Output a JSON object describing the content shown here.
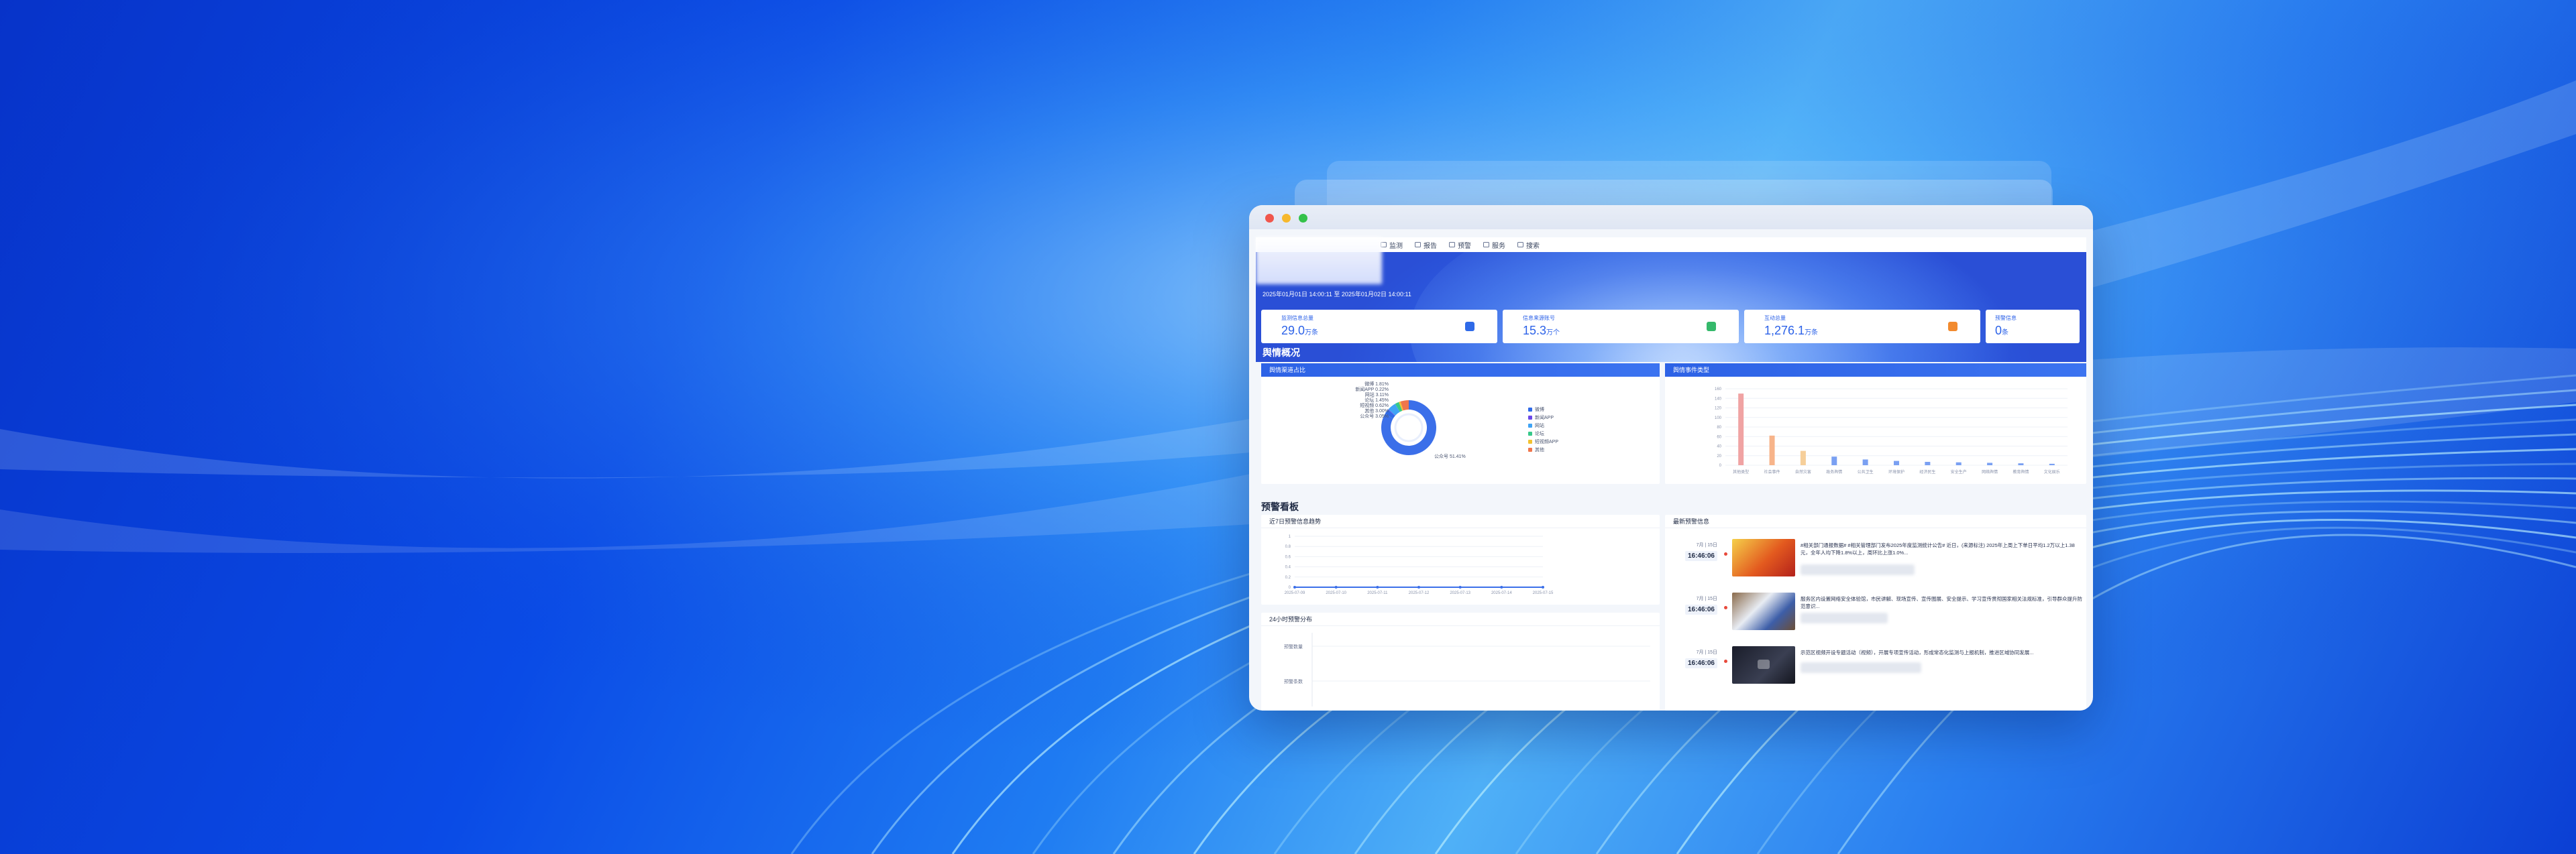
{
  "window": {
    "nav_items": [
      {
        "label": "监测",
        "icon": "monitor-icon"
      },
      {
        "label": "报告",
        "icon": "report-icon"
      },
      {
        "label": "预警",
        "icon": "alert-icon"
      },
      {
        "label": "服务",
        "icon": "service-icon"
      },
      {
        "label": "搜索",
        "icon": "search-icon"
      }
    ],
    "time_range": "2025年01月01日 14:00:11 至 2025年01月02日 14:00:11",
    "stats": [
      {
        "label": "监测信息总量",
        "value": "29.0",
        "unit": "万条",
        "icon_color": "#2f6ae8"
      },
      {
        "label": "信息来源账号",
        "value": "15.3",
        "unit": "万个",
        "icon_color": "#35b96b"
      },
      {
        "label": "互动总量",
        "value": "1,276.1",
        "unit": "万条",
        "icon_color": "#f28a2e"
      },
      {
        "label": "预警信息",
        "value": "0",
        "unit": "条",
        "icon_color": "#2f6ae8"
      }
    ],
    "section_overview": "舆情概况",
    "panel_source": "舆情渠道占比",
    "panel_type": "舆情事件类型",
    "section_warning": "预警看板",
    "panel_trend": "近7日预警信息趋势",
    "panel_24h": "24小时预警分布",
    "panel_latest": "最新预警信息",
    "axis_24h": [
      "预警数量",
      "预警条数"
    ]
  },
  "donut_legend": [
    {
      "label": "微博",
      "color": "#2f6ae8"
    },
    {
      "label": "新闻APP",
      "color": "#6b48e8"
    },
    {
      "label": "网站",
      "color": "#3fa3f5"
    },
    {
      "label": "论坛",
      "color": "#37c88a"
    },
    {
      "label": "短视频APP",
      "color": "#f2c230"
    },
    {
      "label": "其他",
      "color": "#f0764c"
    }
  ],
  "donut_labels": [
    "微博 1.81%",
    "新闻APP 0.22%",
    "网站 3.11%",
    "论坛 1.45%",
    "短视频 0.62%",
    "其他 3.00%",
    "公众号 3.05%"
  ],
  "donut_main_label": "公众号 51.41%",
  "warnings": [
    {
      "date": "7月 | 15日",
      "time": "16:46:06",
      "text": "#相关部门通报数据# #相关管理部门发布2025年度监测统计公告# 近日，(来源标注) 2025年上周上下单日平均1.2万以上1.38元，全年人均下降1.8%以上，周环比上涨1.0%..."
    },
    {
      "date": "7月 | 15日",
      "time": "16:46:06",
      "text": "服务区内设置网络安全体验馆，市民讲解、现场宣传、宣传图展、安全提示、学习宣传贯彻国家相关法规标准，引导群众提升防范意识..."
    },
    {
      "date": "7月 | 15日",
      "time": "16:46:06",
      "text": "示范区视频开设专题活动（视频），开展专项宣传活动，形成常态化监测与上报机制，推进区域协同发展..."
    }
  ],
  "chart_data": [
    {
      "type": "pie",
      "title": "舆情渠道占比",
      "categories": [
        "公众号",
        "微博",
        "新闻APP",
        "网站",
        "论坛",
        "短视频",
        "其他"
      ],
      "values": [
        51.41,
        1.81,
        0.22,
        3.11,
        1.45,
        0.62,
        3.0
      ]
    },
    {
      "type": "bar",
      "title": "舆情事件类型",
      "categories": [
        "其他类型",
        "社会事件",
        "自然灾害",
        "政务舆情",
        "公共卫生",
        "环境保护",
        "经济民生",
        "安全生产",
        "网络舆情",
        "教育舆情",
        "文化娱乐"
      ],
      "values": [
        150,
        62,
        30,
        18,
        12,
        9,
        7,
        6,
        5,
        4,
        3
      ],
      "ylim": [
        0,
        160
      ],
      "yticks": [
        0,
        20,
        40,
        60,
        80,
        100,
        120,
        140,
        160
      ]
    },
    {
      "type": "line",
      "title": "近7日预警信息趋势",
      "x": [
        "2025-07-09",
        "2025-07-10",
        "2025-07-11",
        "2025-07-12",
        "2025-07-13",
        "2025-07-14",
        "2025-07-15"
      ],
      "values": [
        0,
        0,
        0,
        0,
        0,
        0,
        0
      ],
      "ylim": [
        0,
        1
      ],
      "yticks": [
        0,
        0.2,
        0.4,
        0.6,
        0.8,
        1
      ]
    }
  ]
}
